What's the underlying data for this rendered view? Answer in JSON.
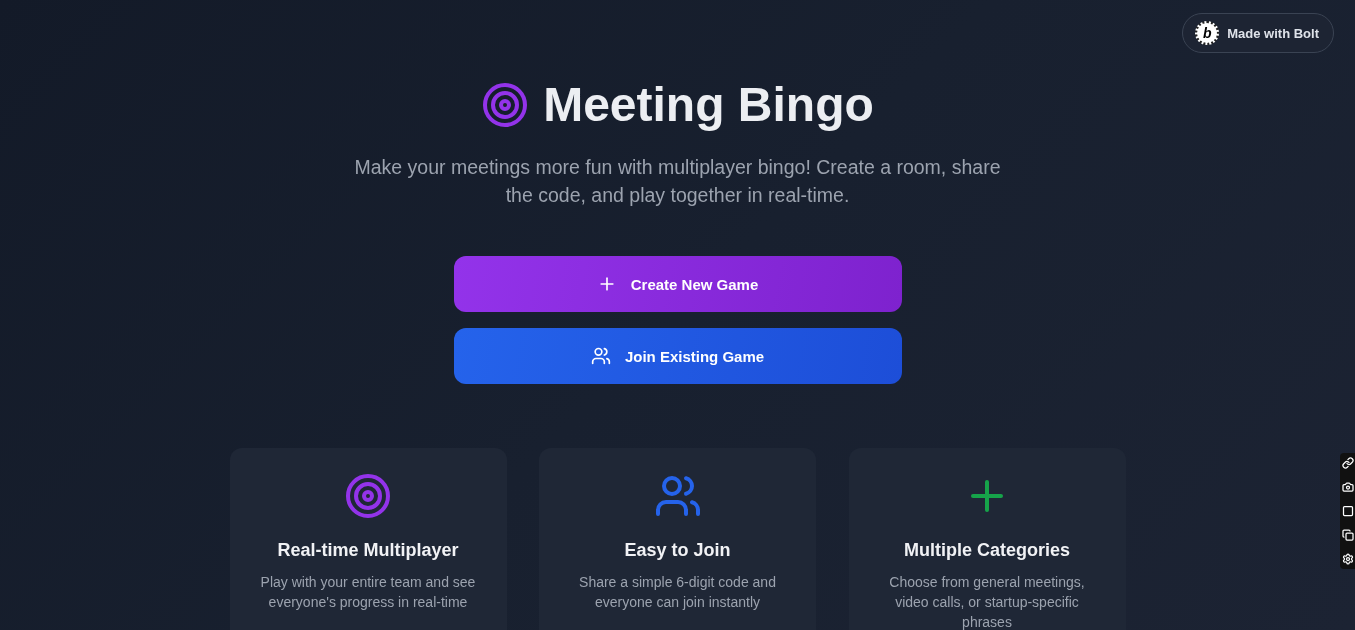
{
  "badge": {
    "logo_letter": "b",
    "label": "Made with Bolt"
  },
  "header": {
    "title": "Meeting Bingo",
    "subtitle": "Make your meetings more fun with multiplayer bingo! Create a room, share the code, and play together in real-time."
  },
  "actions": [
    {
      "kind": "create",
      "label": "Create New Game"
    },
    {
      "kind": "join",
      "label": "Join Existing Game"
    }
  ],
  "features": [
    {
      "kind": "target",
      "color": "#9333ea",
      "title": "Real-time Multiplayer",
      "description": "Play with your entire team and see everyone's progress in real-time"
    },
    {
      "kind": "users",
      "color": "#2563eb",
      "title": "Easy to Join",
      "description": "Share a simple 6-digit code and everyone can join instantly"
    },
    {
      "kind": "plus",
      "color": "#16a34a",
      "title": "Multiple Categories",
      "description": "Choose from general meetings, video calls, or startup-specific phrases"
    }
  ],
  "side_toolbar": {
    "tools": [
      {
        "kind": "link"
      },
      {
        "kind": "camera"
      },
      {
        "kind": "rectangle"
      },
      {
        "kind": "windows"
      },
      {
        "kind": "settings"
      }
    ]
  }
}
